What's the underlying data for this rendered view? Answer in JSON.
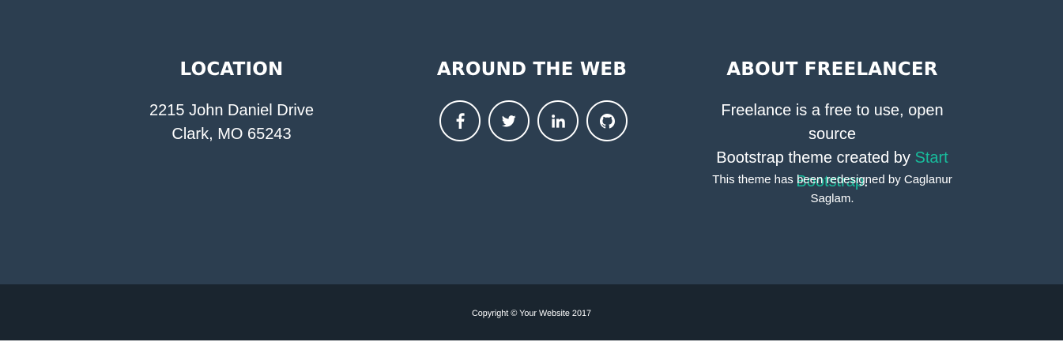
{
  "location": {
    "heading": "LOCATION",
    "address_line1": "2215 John Daniel Drive",
    "address_line2": "Clark, MO 65243"
  },
  "web": {
    "heading": "AROUND THE WEB",
    "links": [
      {
        "icon": "facebook-icon"
      },
      {
        "icon": "twitter-icon"
      },
      {
        "icon": "linkedin-icon"
      },
      {
        "icon": "github-icon"
      }
    ]
  },
  "about": {
    "heading": "ABOUT FREELANCER",
    "text_line1": "Freelance is a free to use, open source",
    "text_line2_prefix": "Bootstrap theme created by",
    "link_part1": "Start",
    "link_part2": "Bootstrap",
    "link_suffix": ".",
    "redesign_line1": "This theme has been redesigned by Caglanur",
    "redesign_line2": "Saglam."
  },
  "copyright": {
    "text": "Copyright © Your Website 2017"
  },
  "colors": {
    "footer_bg": "#2c3e50",
    "copyright_bg": "#1a252f",
    "accent": "#18bc9c",
    "text": "#ffffff"
  }
}
